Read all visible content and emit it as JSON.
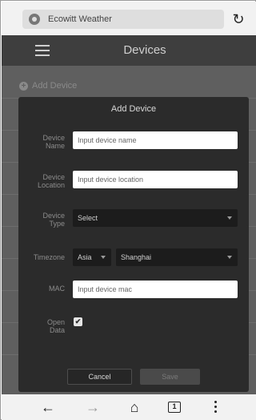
{
  "browser": {
    "url_text": "Ecowitt Weather",
    "tabs_count": "1"
  },
  "app": {
    "title": "Devices",
    "add_device_label": "Add Device"
  },
  "dialog": {
    "title": "Add Device",
    "fields": {
      "device_name": {
        "label_line1": "Device",
        "label_line2": "Name",
        "placeholder": "Input device name"
      },
      "device_location": {
        "label_line1": "Device",
        "label_line2": "Location",
        "placeholder": "Input device location"
      },
      "device_type": {
        "label_line1": "Device",
        "label_line2": "Type",
        "value": "Select"
      },
      "timezone": {
        "label": "Timezone",
        "region": "Asia",
        "city": "Shanghai"
      },
      "mac": {
        "label": "MAC",
        "placeholder": "Input device mac"
      },
      "open_data": {
        "label_line1": "Open",
        "label_line2": "Data",
        "checked": true,
        "check_glyph": "✔"
      }
    },
    "cancel_label": "Cancel",
    "save_label": "Save"
  },
  "icons": {
    "site": "globe-icon",
    "reload": "reload-icon",
    "menu": "hamburger-menu-icon",
    "add": "plus-circle-icon",
    "back": "back-arrow-icon",
    "forward": "forward-arrow-icon",
    "home": "home-icon",
    "tabs": "tabs-icon",
    "more": "more-vert-icon"
  },
  "colors": {
    "dialog_bg": "#2b2b2b",
    "app_bar": "#3e3e3e",
    "overlay": "#5f5f5f"
  }
}
